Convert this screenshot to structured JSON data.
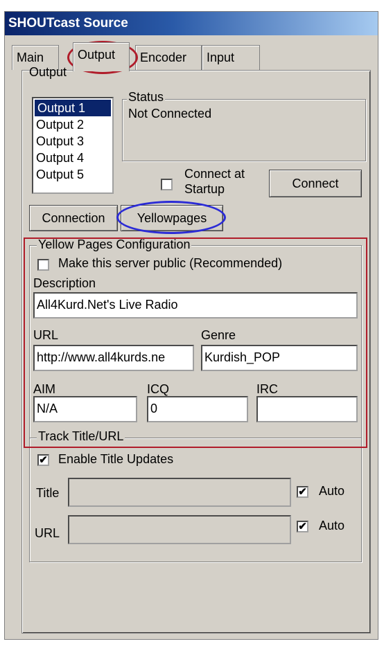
{
  "window": {
    "title": "SHOUTcast Source"
  },
  "tabs": [
    "Main",
    "Output",
    "Encoder",
    "Input"
  ],
  "output": {
    "label": "Output",
    "list": [
      "Output 1",
      "Output 2",
      "Output 3",
      "Output 4",
      "Output 5"
    ],
    "selected": "Output 1",
    "status_legend": "Status",
    "status_text": "Not Connected",
    "connect_at_startup_label_1": "Connect at",
    "connect_at_startup_label_2": "Startup",
    "connect_at_startup_checked": false,
    "connect_button": "Connect"
  },
  "subtabs": {
    "connection": "Connection",
    "yellowpages": "Yellowpages"
  },
  "yp": {
    "legend": "Yellow Pages Configuration",
    "public_label": "Make this server public (Recommended)",
    "public_checked": false,
    "description_label": "Description",
    "description_value": "All4Kurd.Net's Live Radio",
    "url_label": "URL",
    "url_value": "http://www.all4kurds.ne",
    "genre_label": "Genre",
    "genre_value": "Kurdish_POP",
    "aim_label": "AIM",
    "aim_value": "N/A",
    "icq_label": "ICQ",
    "icq_value": "0",
    "irc_label": "IRC",
    "irc_value": ""
  },
  "track": {
    "legend": "Track Title/URL",
    "enable_label": "Enable Title Updates",
    "enable_checked": true,
    "title_label": "Title",
    "title_value": "",
    "title_auto_label": "Auto",
    "title_auto_checked": true,
    "url_label": "URL",
    "url_value": "",
    "url_auto_label": "Auto",
    "url_auto_checked": true
  },
  "check_mark": "✔",
  "colors": {
    "annotation_red": "#b01c2a",
    "annotation_blue": "#2b2bd6",
    "selection": "#0a246a"
  }
}
